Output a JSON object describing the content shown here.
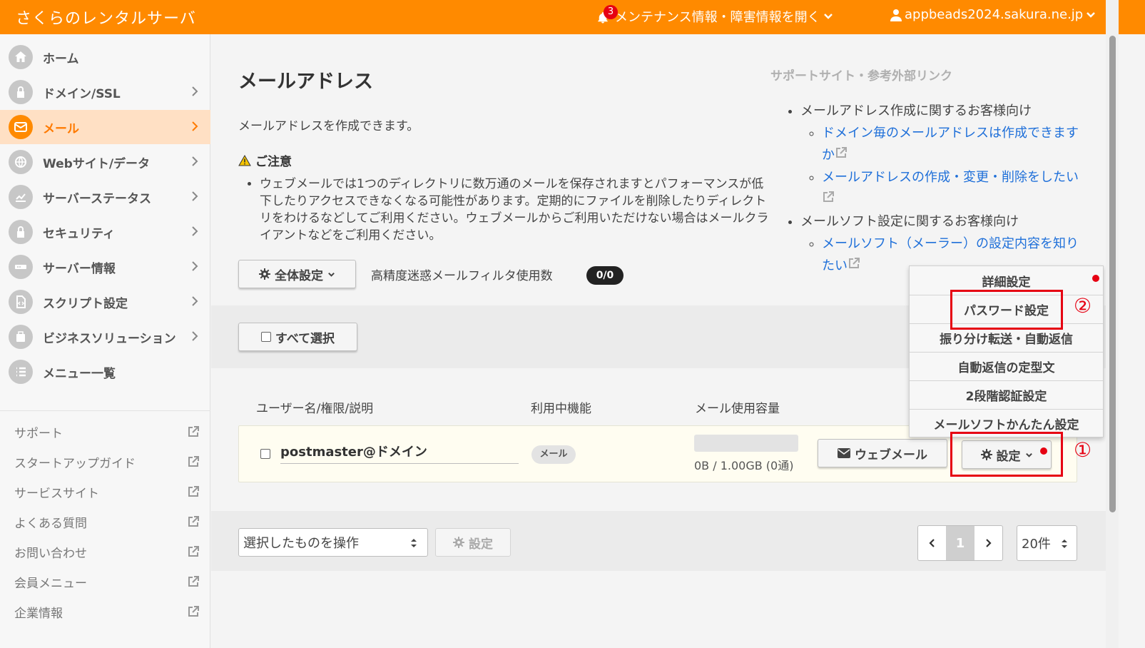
{
  "header": {
    "brand": "さくらのレンタルサーバ",
    "notifications_count": "3",
    "maintenance_label": "メンテナンス情報・障害情報を開く",
    "user_label": "appbeads2024.sakura.ne.jp",
    "bg_color": "#ff8a00"
  },
  "sidebar": {
    "items": [
      {
        "label": "ホーム",
        "icon": "home-icon"
      },
      {
        "label": "ドメイン/SSL",
        "icon": "ssl-lock-icon"
      },
      {
        "label": "メール",
        "icon": "mail-icon"
      },
      {
        "label": "Webサイト/データ",
        "icon": "globe-icon"
      },
      {
        "label": "サーバーステータス",
        "icon": "chart-icon"
      },
      {
        "label": "セキュリティ",
        "icon": "lock-icon"
      },
      {
        "label": "サーバー情報",
        "icon": "server-icon"
      },
      {
        "label": "スクリプト設定",
        "icon": "script-file-icon"
      },
      {
        "label": "ビジネスソリューション",
        "icon": "briefcase-icon"
      },
      {
        "label": "メニュー一覧",
        "icon": "list-icon"
      }
    ],
    "active": "メール",
    "links": [
      "サポート",
      "スタートアップガイド",
      "サービスサイト",
      "よくある質問",
      "お問い合わせ",
      "会員メニュー",
      "企業情報"
    ]
  },
  "main": {
    "title": "メールアドレス",
    "description": "メールアドレスを作成できます。",
    "notice_title": "ご注意",
    "notice_text": "ウェブメールでは1つのディレクトリに数万通のメールを保存されますとパフォーマンスが低下したりアクセスできなくなる可能性があります。定期的にファイルを削除したりディレクトリをわけるなどしてご利用ください。ウェブメールからご利用いただけない場合はメールクライアントなどをご利用ください。",
    "global_settings_label": "全体設定",
    "filter_label": "高精度迷惑メールフィルタ使用数",
    "filter_count": "0/0",
    "select_all_label": "すべて選択",
    "columns": [
      "ユーザー名/権限/説明",
      "利用中機能",
      "メール使用容量"
    ],
    "row": {
      "address": "postmaster@ドメイン",
      "feature": "メール",
      "usage": "0B / 1.00GB (0通)",
      "webmail_label": "ウェブメール",
      "settings_label": "設定"
    },
    "bulk_select": "選択したものを操作",
    "bulk_settings_label": "設定",
    "page": "1",
    "per_page": "20件"
  },
  "support": {
    "title": "サポートサイト・参考外部リンク",
    "group1": "メールアドレス作成に関するお客様向け",
    "link1": "ドメイン毎のメールアドレスは作成できますか",
    "link2": "メールアドレスの作成・変更・削除をしたい",
    "group2": "メールソフト設定に関するお客様向け",
    "link3": "メールソフト（メーラー）の設定内容を知りたい"
  },
  "dropdown": {
    "items": [
      "詳細設定",
      "パスワード設定",
      "振り分け転送・自動返信",
      "自動返信の定型文",
      "2段階認証設定",
      "メールソフトかんたん設定"
    ]
  },
  "annotations": {
    "step1": "①",
    "step2": "②"
  }
}
